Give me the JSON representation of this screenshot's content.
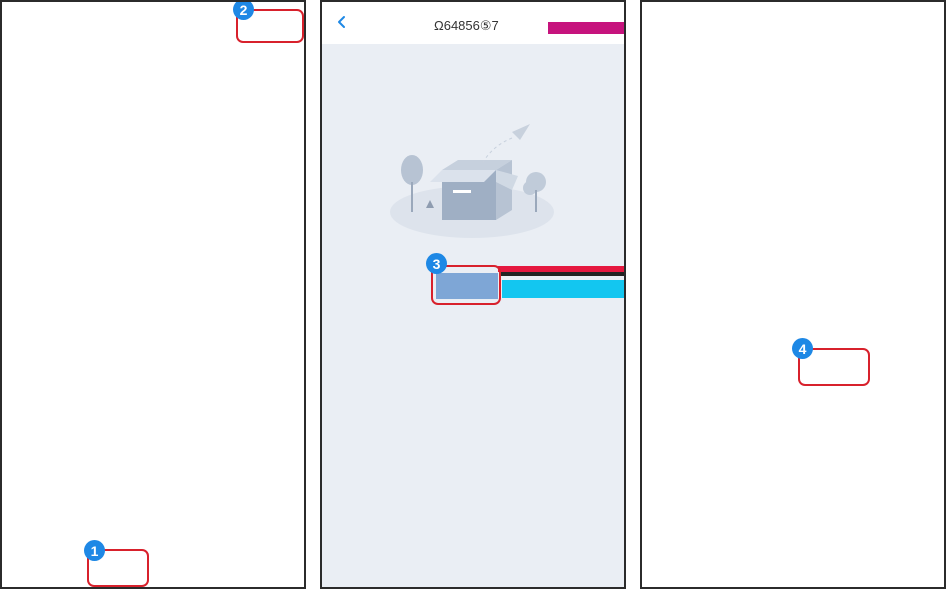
{
  "panels": [
    {
      "step_badge": "1",
      "second_badge": "2"
    },
    {
      "title": "Ω64856⑤7",
      "step_badge": "3"
    },
    {
      "step_badge": "4"
    }
  ],
  "icons": {
    "back": "chevron-left-icon",
    "illustration": "empty-box-icon"
  },
  "colors": {
    "highlight": "#d8212c",
    "badge": "#1e88e5",
    "panel2_bg": "#eaeef4",
    "back_icon": "#1e88e5"
  }
}
